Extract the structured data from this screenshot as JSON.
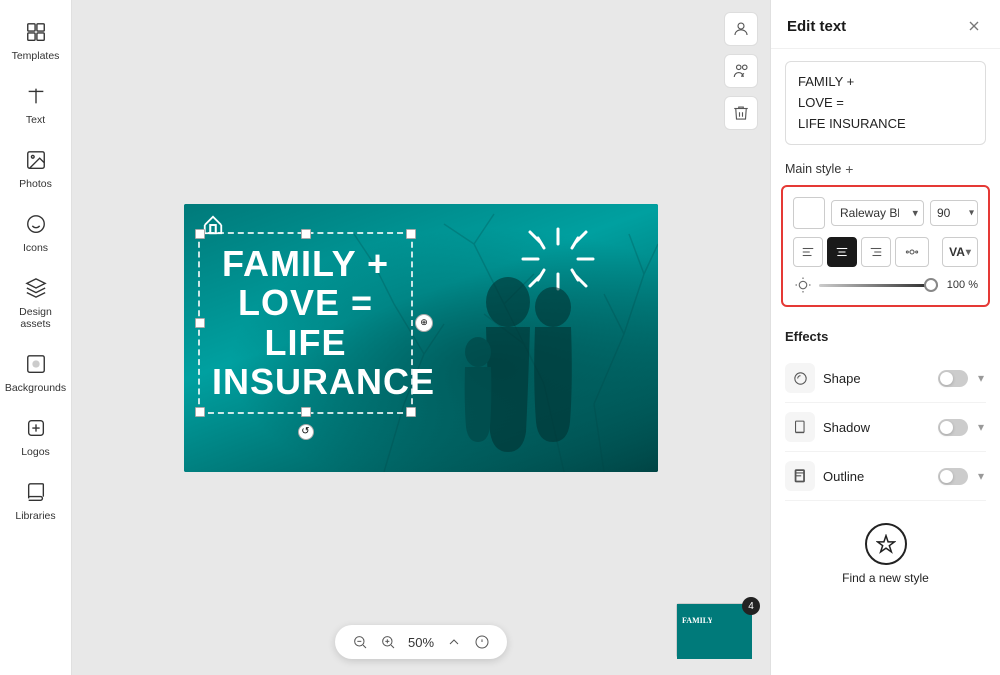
{
  "sidebar": {
    "items": [
      {
        "id": "templates",
        "label": "Templates",
        "icon": "grid"
      },
      {
        "id": "text",
        "label": "Text",
        "icon": "text"
      },
      {
        "id": "photos",
        "label": "Photos",
        "icon": "image"
      },
      {
        "id": "icons",
        "label": "Icons",
        "icon": "smiley"
      },
      {
        "id": "design-assets",
        "label": "Design assets",
        "icon": "layers"
      },
      {
        "id": "backgrounds",
        "label": "Backgrounds",
        "icon": "background"
      },
      {
        "id": "logos",
        "label": "Logos",
        "icon": "badge"
      },
      {
        "id": "libraries",
        "label": "Libraries",
        "icon": "library"
      }
    ]
  },
  "canvas_toolbar": {
    "avatar_icon": "avatar",
    "user_icon": "user-circle",
    "delete_icon": "trash"
  },
  "bottom_toolbar": {
    "zoom_out_label": "−",
    "zoom_in_label": "+",
    "zoom_value": "50%",
    "info_label": "ⓘ"
  },
  "thumbnail": {
    "badge": "4"
  },
  "design": {
    "text_lines": [
      "FAMILY +",
      "LOVE =",
      "LIFE",
      "INSURANCE"
    ]
  },
  "panel": {
    "title": "Edit text",
    "close_label": "×",
    "text_preview_line1": "FAMILY +",
    "text_preview_line2": "LOVE =",
    "text_preview_line3": "LIFE INSURANCE",
    "main_style_label": "Main style",
    "main_style_plus": "+",
    "font_name": "Raleway Black",
    "font_size": "90",
    "alignment": {
      "left": "left",
      "center": "center",
      "right": "right"
    },
    "opacity_label": "100 %",
    "effects_title": "Effects",
    "effects": [
      {
        "id": "shape",
        "label": "Shape",
        "icon": "shape"
      },
      {
        "id": "shadow",
        "label": "Shadow",
        "icon": "shadow"
      },
      {
        "id": "outline",
        "label": "Outline",
        "icon": "outline"
      }
    ],
    "find_style_label": "Find a new style"
  }
}
